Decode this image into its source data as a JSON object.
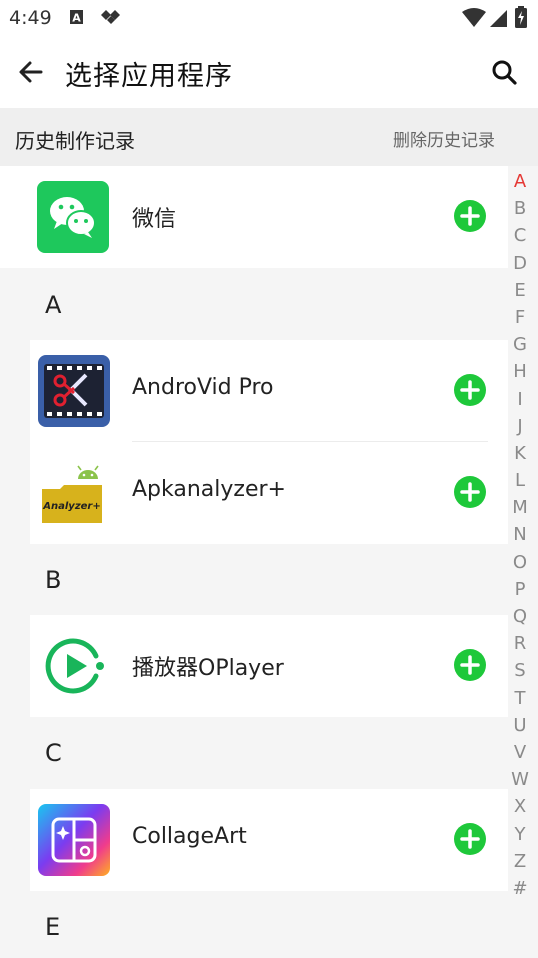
{
  "status_bar": {
    "time": "4:49",
    "icons": [
      "notification-a-icon",
      "notification-diamond-icon",
      "wifi-icon",
      "cellular-signal-icon",
      "battery-icon"
    ]
  },
  "app_bar": {
    "title": "选择应用程序",
    "back_icon": "arrow-left-icon",
    "search_icon": "search-icon"
  },
  "history": {
    "title": "历史制作记录",
    "clear_label": "删除历史记录",
    "items": [
      {
        "label": "微信",
        "icon": "wechat-icon",
        "color": "#1ec85c"
      }
    ]
  },
  "sections": [
    {
      "letter": "A",
      "apps": [
        {
          "label": "AndroVid Pro",
          "icon": "androvid-icon",
          "color": "#3a5fa8"
        },
        {
          "label": "Apkanalyzer+",
          "icon": "apkanalyzer-icon",
          "color": "#d4b11a"
        }
      ]
    },
    {
      "letter": "B",
      "apps": [
        {
          "label": "播放器OPlayer",
          "icon": "oplayer-icon",
          "color": "#19b55a"
        }
      ]
    },
    {
      "letter": "C",
      "apps": [
        {
          "label": "CollageArt",
          "icon": "collageart-icon",
          "color": "#7b3cf0"
        }
      ]
    },
    {
      "letter": "E",
      "apps": []
    }
  ],
  "add_button_color": "#1ec83a",
  "index": {
    "letters": [
      "A",
      "B",
      "C",
      "D",
      "E",
      "F",
      "G",
      "H",
      "I",
      "J",
      "K",
      "L",
      "M",
      "N",
      "O",
      "P",
      "Q",
      "R",
      "S",
      "T",
      "U",
      "V",
      "W",
      "X",
      "Y",
      "Z",
      "#"
    ],
    "active": "A",
    "active_color": "#e53935"
  }
}
